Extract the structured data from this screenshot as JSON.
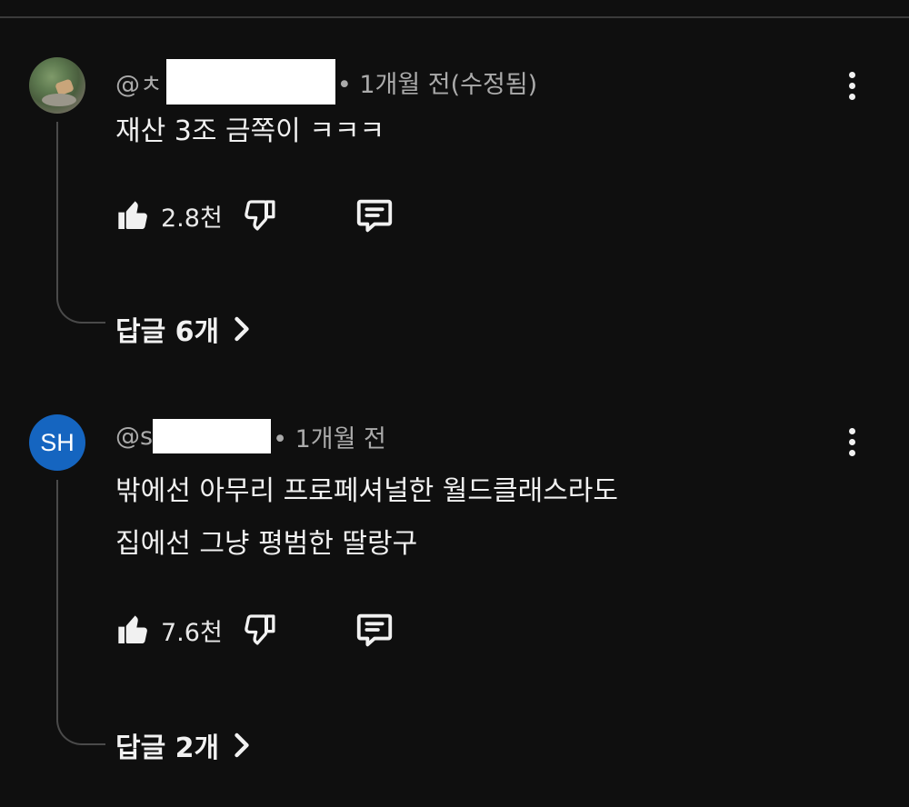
{
  "comments": [
    {
      "handle_prefix": "@ㅊ",
      "timestamp": "• 1개월 전(수정됨)",
      "text_lines": [
        "재산 3조 금쪽이 ㅋㅋㅋ"
      ],
      "likes": "2.8천",
      "replies_label": "답글 6개",
      "avatar_type": "photo"
    },
    {
      "handle_prefix": "@s",
      "timestamp": "• 1개월 전",
      "text_lines": [
        "밖에선 아무리 프로페셔널한 월드클래스라도",
        "집에선 그냥 평범한 딸랑구"
      ],
      "likes": "7.6천",
      "replies_label": "답글 2개",
      "avatar_type": "initials",
      "avatar_initials": "SH",
      "avatar_color": "#1565c0"
    }
  ],
  "icons": {
    "like": "thumbs-up-icon",
    "dislike": "thumbs-down-icon",
    "reply": "comment-icon",
    "more": "more-vert-icon",
    "chevron": "chevron-right-icon"
  },
  "colors": {
    "background": "#0f0f0f",
    "text": "#f1f1f1",
    "meta": "#aaaaaa"
  }
}
